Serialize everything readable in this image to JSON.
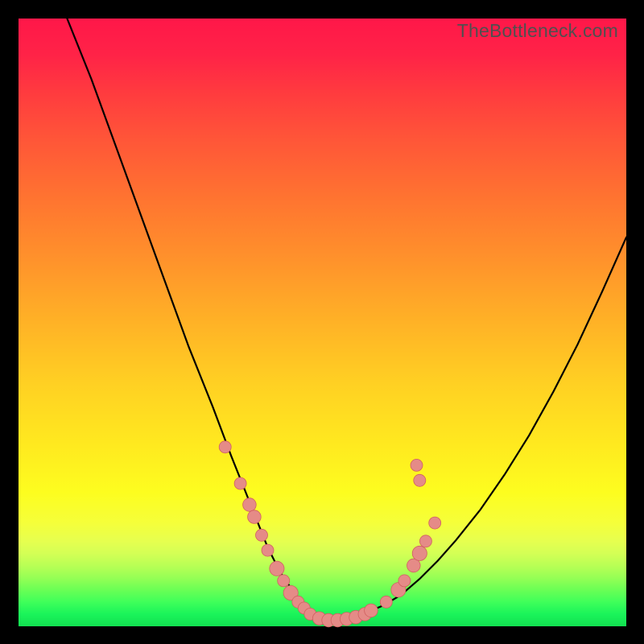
{
  "watermark": "TheBottleneck.com",
  "colors": {
    "frame_bg": "#000000",
    "curve_stroke": "#000000",
    "marker_fill": "#e58b87",
    "marker_stroke": "#d06060"
  },
  "chart_data": {
    "type": "line",
    "title": "",
    "xlabel": "",
    "ylabel": "",
    "xlim": [
      0,
      100
    ],
    "ylim": [
      0,
      100
    ],
    "grid": false,
    "legend": false,
    "series": [
      {
        "name": "left-curve",
        "x": [
          8,
          12,
          16,
          20,
          24,
          28,
          32,
          35,
          37,
          39,
          41,
          43,
          45,
          47,
          49,
          51
        ],
        "y": [
          100,
          90,
          79,
          68,
          57,
          46,
          36,
          28,
          23,
          18,
          13,
          9,
          6,
          3.5,
          1.8,
          1
        ]
      },
      {
        "name": "right-curve",
        "x": [
          51,
          54,
          57,
          60,
          63,
          66,
          69,
          72,
          76,
          80,
          84,
          88,
          92,
          96,
          100
        ],
        "y": [
          1,
          1.4,
          2.2,
          3.4,
          5.2,
          7.8,
          10.8,
          14.2,
          19.2,
          25,
          31.4,
          38.6,
          46.4,
          55,
          64
        ]
      }
    ],
    "markers": [
      {
        "x": 34.0,
        "y": 29.5,
        "r": 1.0
      },
      {
        "x": 36.5,
        "y": 23.5,
        "r": 1.0
      },
      {
        "x": 38.0,
        "y": 20.0,
        "r": 1.1
      },
      {
        "x": 38.8,
        "y": 18.0,
        "r": 1.1
      },
      {
        "x": 40.0,
        "y": 15.0,
        "r": 1.0
      },
      {
        "x": 41.0,
        "y": 12.5,
        "r": 1.0
      },
      {
        "x": 42.5,
        "y": 9.5,
        "r": 1.2
      },
      {
        "x": 43.6,
        "y": 7.5,
        "r": 1.0
      },
      {
        "x": 44.8,
        "y": 5.5,
        "r": 1.2
      },
      {
        "x": 46.0,
        "y": 4.0,
        "r": 1.0
      },
      {
        "x": 47.0,
        "y": 3.0,
        "r": 1.0
      },
      {
        "x": 48.0,
        "y": 2.0,
        "r": 1.0
      },
      {
        "x": 49.5,
        "y": 1.3,
        "r": 1.1
      },
      {
        "x": 51.0,
        "y": 1.0,
        "r": 1.1
      },
      {
        "x": 52.5,
        "y": 1.0,
        "r": 1.1
      },
      {
        "x": 54.0,
        "y": 1.2,
        "r": 1.1
      },
      {
        "x": 55.5,
        "y": 1.5,
        "r": 1.1
      },
      {
        "x": 57.0,
        "y": 2.0,
        "r": 1.1
      },
      {
        "x": 58.0,
        "y": 2.6,
        "r": 1.1
      },
      {
        "x": 60.5,
        "y": 4.0,
        "r": 1.0
      },
      {
        "x": 62.5,
        "y": 6.0,
        "r": 1.2
      },
      {
        "x": 63.5,
        "y": 7.5,
        "r": 1.0
      },
      {
        "x": 65.0,
        "y": 10.0,
        "r": 1.1
      },
      {
        "x": 66.0,
        "y": 12.0,
        "r": 1.2
      },
      {
        "x": 67.0,
        "y": 14.0,
        "r": 1.0
      },
      {
        "x": 68.5,
        "y": 17.0,
        "r": 1.0
      },
      {
        "x": 66.0,
        "y": 24.0,
        "r": 1.0
      },
      {
        "x": 65.5,
        "y": 26.5,
        "r": 1.0
      }
    ]
  }
}
